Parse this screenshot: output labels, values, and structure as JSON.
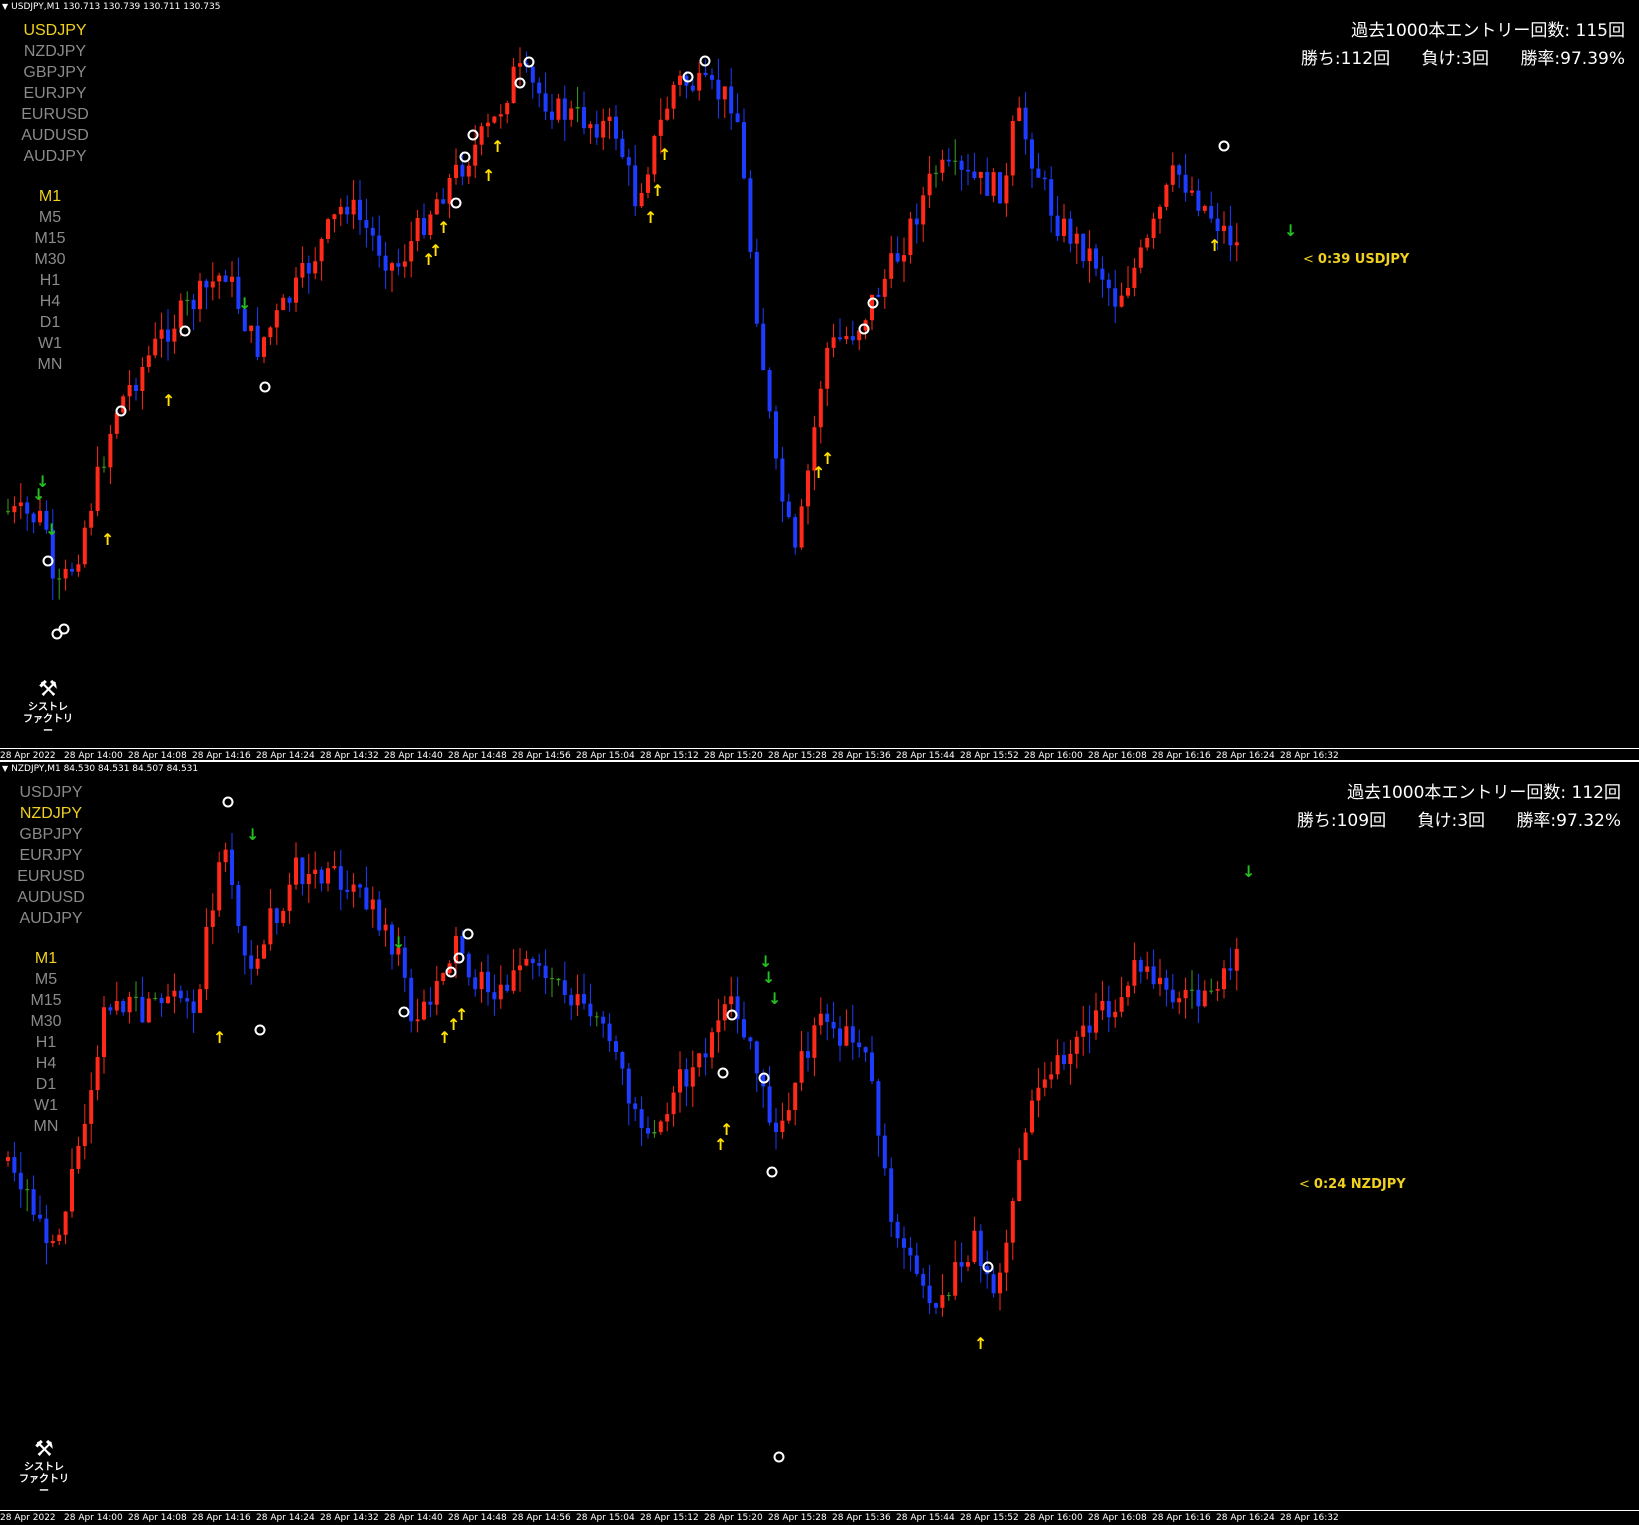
{
  "colors": {
    "up": "#ff2a1a",
    "down": "#1e3cff",
    "doji": "#3aa020",
    "accent": "#f0d020",
    "arrow_up": "#ffe000",
    "arrow_down": "#22c020",
    "circle": "#ffffff"
  },
  "symbols": [
    "USDJPY",
    "NZDJPY",
    "GBPJPY",
    "EURJPY",
    "EURUSD",
    "AUDUSD",
    "AUDJPY"
  ],
  "timeframes": [
    "M1",
    "M5",
    "M15",
    "M30",
    "H1",
    "H4",
    "D1",
    "W1",
    "MN"
  ],
  "logo": {
    "icon": "wrench-screwdriver-icon",
    "line1": "シストレ",
    "line2": "ファクトリー"
  },
  "xaxis_labels": [
    "28 Apr 2022",
    "28 Apr 14:00",
    "28 Apr 14:08",
    "28 Apr 14:16",
    "28 Apr 14:24",
    "28 Apr 14:32",
    "28 Apr 14:40",
    "28 Apr 14:48",
    "28 Apr 14:56",
    "28 Apr 15:04",
    "28 Apr 15:12",
    "28 Apr 15:20",
    "28 Apr 15:28",
    "28 Apr 15:36",
    "28 Apr 15:44",
    "28 Apr 15:52",
    "28 Apr 16:00",
    "28 Apr 16:08",
    "28 Apr 16:16",
    "28 Apr 16:24",
    "28 Apr 16:32"
  ],
  "top": {
    "header": "USDJPY,M1  130.713 130.739 130.711 130.735",
    "active_symbol": "USDJPY",
    "active_timeframe": "M1",
    "stats_line1": "過去1000本エントリー回数: 115回",
    "wins": "勝ち:112回",
    "losses": "負け:3回",
    "winrate": "勝率:97.39%",
    "countdown_arrow": "<",
    "countdown": "0:39 USDJPY"
  },
  "bottom": {
    "header": "NZDJPY,M1  84.530 84.531 84.507 84.531",
    "active_symbol": "NZDJPY",
    "active_timeframe": "M1",
    "stats_line1": "過去1000本エントリー回数: 112回",
    "wins": "勝ち:109回",
    "losses": "負け:3回",
    "winrate": "勝率:97.32%",
    "countdown_arrow": "<",
    "countdown": "0:24 NZDJPY"
  }
}
